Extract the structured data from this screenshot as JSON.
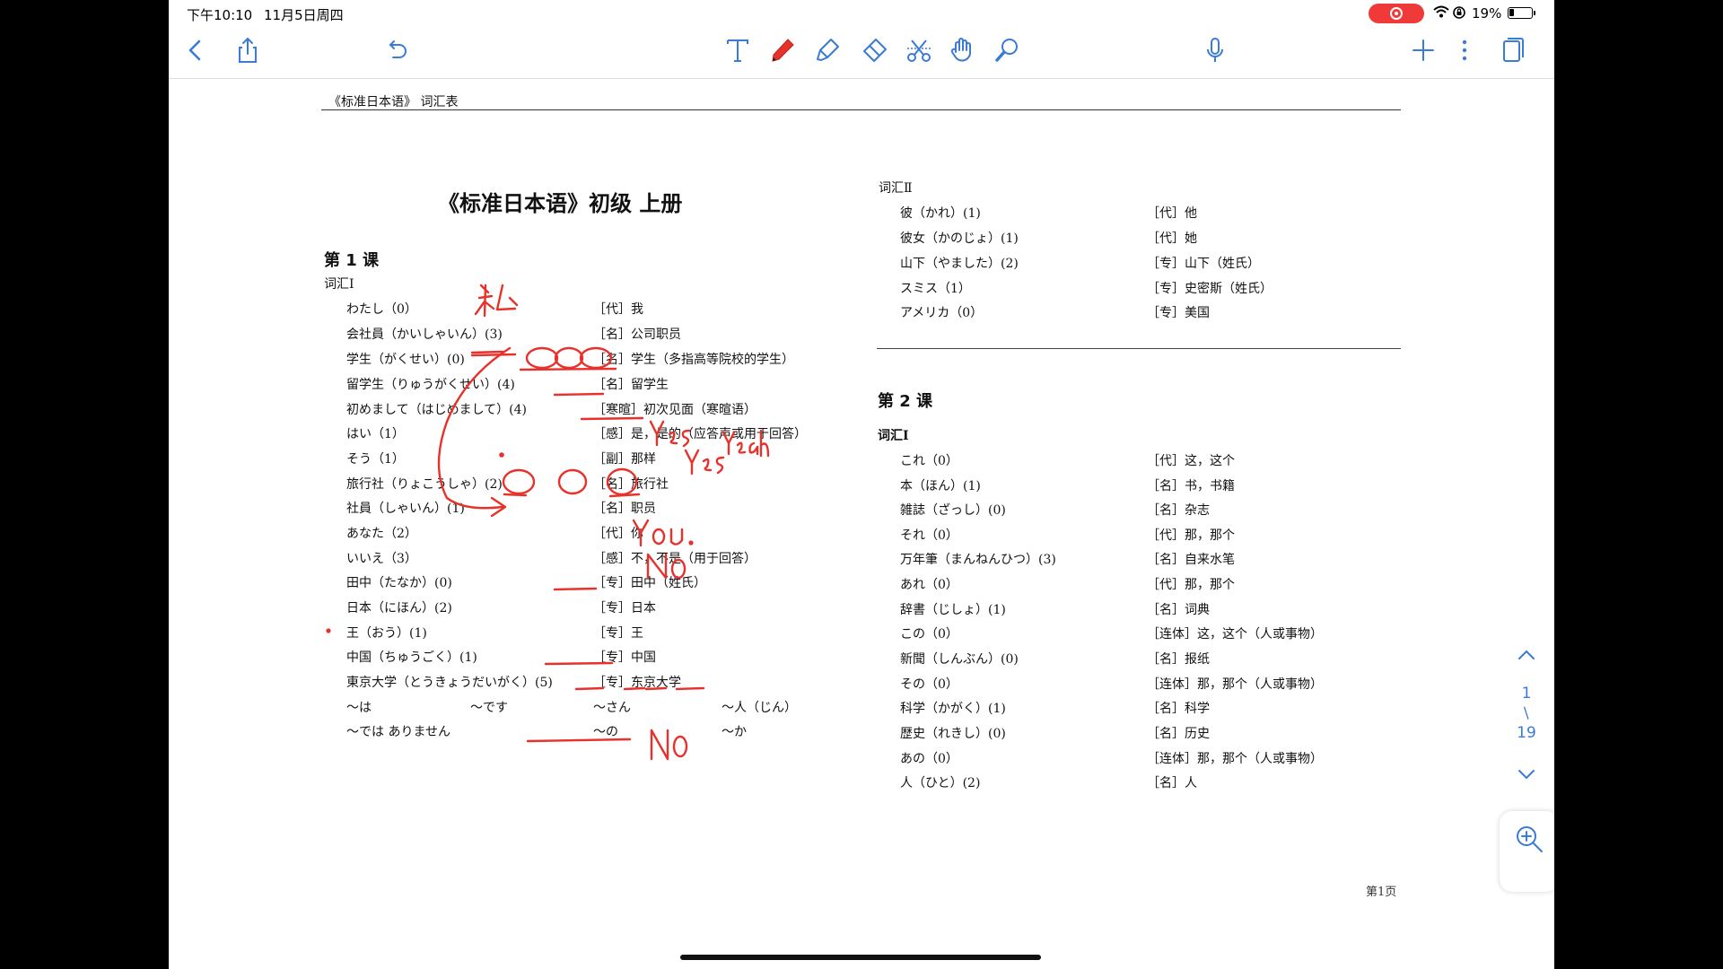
{
  "status_bar": {
    "time": "下午10:10",
    "date": "11月5日周四",
    "battery": "19%"
  },
  "toolbar": {
    "icons": [
      "back-icon",
      "share-icon",
      "undo-icon",
      "text-tool-icon",
      "pen-tool-icon",
      "highlighter-tool-icon",
      "eraser-tool-icon",
      "lasso-scissors-icon",
      "hand-tool-icon",
      "magnifier-tool-icon",
      "microphone-icon",
      "add-icon",
      "more-icon",
      "pages-icon"
    ],
    "active_tool_color": "#e8312b"
  },
  "document": {
    "header": "《标准日本语》 词汇表",
    "title": "《标准日本语》初级 上册",
    "lesson1": {
      "heading": "第 1 课",
      "vocab_heading": "词汇Ⅰ",
      "rows": [
        {
          "word": "わたし（0）",
          "meaning": "［代］我"
        },
        {
          "word": "会社員（かいしゃいん）(3)",
          "meaning": "［名］公司职员"
        },
        {
          "word": "学生（がくせい）(0)",
          "meaning": "［名］学生（多指高等院校的学生）"
        },
        {
          "word": "留学生（りゅうがくせい）(4)",
          "meaning": "［名］留学生"
        },
        {
          "word": "初めまして（はじめまして）(4)",
          "meaning": "［寒暄］初次见面（寒暄语）"
        },
        {
          "word": "はい（1）",
          "meaning": "［感］是，是的（应答声或用于回答）"
        },
        {
          "word": "そう（1）",
          "meaning": "［副］那样"
        },
        {
          "word": "旅行社（りょこうしゃ）(2)",
          "meaning": "［名］旅行社"
        },
        {
          "word": "社員（しゃいん）(1)",
          "meaning": "［名］职员"
        },
        {
          "word": "あなた（2）",
          "meaning": "［代］你"
        },
        {
          "word": "いいえ（3）",
          "meaning": "［感］不，不是（用于回答）"
        },
        {
          "word": "田中（たなか）(0)",
          "meaning": "［专］田中（姓氏）"
        },
        {
          "word": "日本（にほん）(2)",
          "meaning": "［专］日本"
        },
        {
          "word": "王（おう）(1)",
          "meaning": "［专］王"
        },
        {
          "word": "中国（ちゅうごく）(1)",
          "meaning": "［专］中国"
        },
        {
          "word": "東京大学（とうきょうだいがく）(5)",
          "meaning": "［专］东京大学"
        }
      ],
      "affixes": [
        [
          "～は",
          "～です",
          "～さん",
          "～人（じん）"
        ],
        [
          "～では ありません",
          "",
          "～の",
          "～か"
        ]
      ]
    },
    "vocab2": {
      "heading": "词汇Ⅱ",
      "rows": [
        {
          "word": "彼（かれ）(1)",
          "meaning": "［代］他"
        },
        {
          "word": "彼女（かのじょ）(1)",
          "meaning": "［代］她"
        },
        {
          "word": "山下（やました）(2)",
          "meaning": "［专］山下（姓氏）"
        },
        {
          "word": "スミス（1）",
          "meaning": "［专］史密斯（姓氏）"
        },
        {
          "word": "アメリカ（0）",
          "meaning": "［专］美国"
        }
      ]
    },
    "lesson2": {
      "heading": "第 2 课",
      "vocab_heading": "词汇Ⅰ",
      "rows": [
        {
          "word": "これ（0）",
          "meaning": "［代］这，这个"
        },
        {
          "word": "本（ほん）(1)",
          "meaning": "［名］书，书籍"
        },
        {
          "word": "雑誌（ざっし）(0)",
          "meaning": "［名］杂志"
        },
        {
          "word": "それ（0）",
          "meaning": "［代］那，那个"
        },
        {
          "word": "万年筆（まんねんひつ）(3)",
          "meaning": "［名］自来水笔"
        },
        {
          "word": "あれ（0）",
          "meaning": "［代］那，那个"
        },
        {
          "word": "辞書（じしょ）(1)",
          "meaning": "［名］词典"
        },
        {
          "word": "この（0）",
          "meaning": "［连体］这，这个（人或事物）"
        },
        {
          "word": "新聞（しんぶん）(0)",
          "meaning": "［名］报纸"
        },
        {
          "word": "その（0）",
          "meaning": "［连体］那，那个（人或事物）"
        },
        {
          "word": "科学（かがく）(1)",
          "meaning": "［名］科学"
        },
        {
          "word": "歴史（れきし）(0)",
          "meaning": "［名］历史"
        },
        {
          "word": "あの（0）",
          "meaning": "［连体］那，那个（人或事物）"
        },
        {
          "word": "人（ひと）(2)",
          "meaning": "［名］人"
        }
      ]
    },
    "footer": "第1页"
  },
  "annotations": [
    "私",
    "Yes",
    "Yes",
    "Yeah",
    "You.",
    "No",
    "No"
  ],
  "pager": {
    "current": "1",
    "slash": "/",
    "total": "19"
  }
}
